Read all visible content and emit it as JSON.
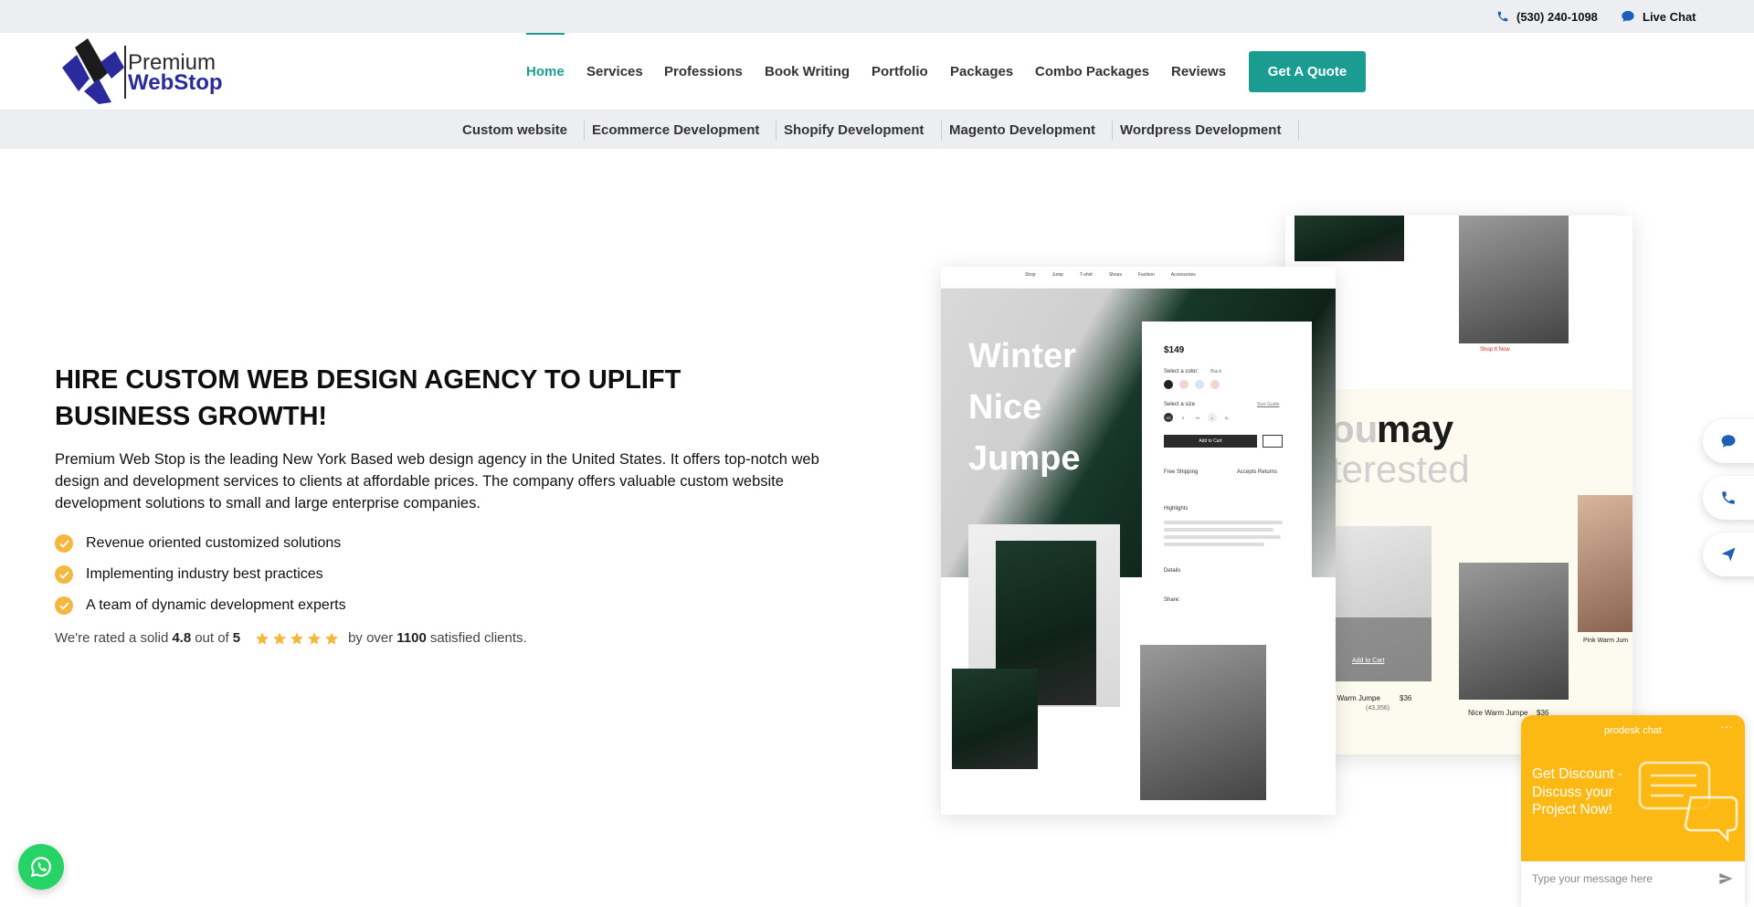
{
  "topbar": {
    "phone": "(530) 240-1098",
    "chat": "Live Chat"
  },
  "logo": {
    "line1": "Premium",
    "line2": "WebStop"
  },
  "nav": {
    "items": [
      "Home",
      "Services",
      "Professions",
      "Book Writing",
      "Portfolio",
      "Packages",
      "Combo Packages",
      "Reviews"
    ],
    "active": "Home",
    "cta": "Get A Quote"
  },
  "subnav": {
    "items": [
      "Custom website",
      "Ecommerce Development",
      "Shopify Development",
      "Magento Development",
      "Wordpress Development"
    ]
  },
  "hero": {
    "title": "HIRE CUSTOM WEB DESIGN AGENCY TO UPLIFT BUSINESS GROWTH!",
    "description": "Premium Web Stop is the leading New York Based web design agency in the United States. It offers top-notch web design and development services to clients at affordable prices. The company offers valuable custom website development solutions to small and large enterprise companies.",
    "bullets": [
      "Revenue oriented customized solutions",
      "Implementing industry best practices",
      "A team of dynamic development experts"
    ],
    "rating": {
      "prefix": "We're rated a solid",
      "score": "4.8",
      "middle": "out of",
      "max": "5",
      "by": "by over",
      "clients": "1100",
      "suffix": "satisfied clients.",
      "stars_filled": 5
    }
  },
  "mockup": {
    "hero_text": [
      "Winter",
      "Nice",
      "Jumpe"
    ],
    "price": "$149",
    "select_color": "Select a color:",
    "color_value": "Black",
    "select_size": "Select a size",
    "size_guide": "Size Guide",
    "sizes": [
      "XS",
      "S",
      "M",
      "L",
      "XL"
    ],
    "add_to_cart": "Add to Cart",
    "free_shipping": "Free Shipping",
    "accepts_returns": "Accepts Returns",
    "highlights": "Highlights",
    "details": "Details",
    "share": "Share:",
    "nav_items": [
      "Shop",
      "Jump",
      "T-shirt",
      "Shoes",
      "Fashion",
      "Accessories"
    ],
    "may_text_a": "ou",
    "may_text_b": "may",
    "interested_text": "terested",
    "product1": "o Warm Jumpe",
    "product1_price": "$36",
    "product2": "Nice Warm Jumpe",
    "product2_price": "$36",
    "product3": "Pink Warm Jum",
    "reviews_count": "(43,356)",
    "shop_now": "Shop It Now",
    "add_to_cart2": "Add to Cart"
  },
  "chat_widget": {
    "brand": "prodesk chat",
    "message": "Get Discount - Discuss your Project Now!",
    "placeholder": "Type your message here"
  },
  "colors": {
    "accent": "#1a9c91",
    "star": "#f4b740",
    "chat": "#fdb913",
    "whatsapp": "#25d366",
    "brand_blue": "#2a2a9c"
  }
}
